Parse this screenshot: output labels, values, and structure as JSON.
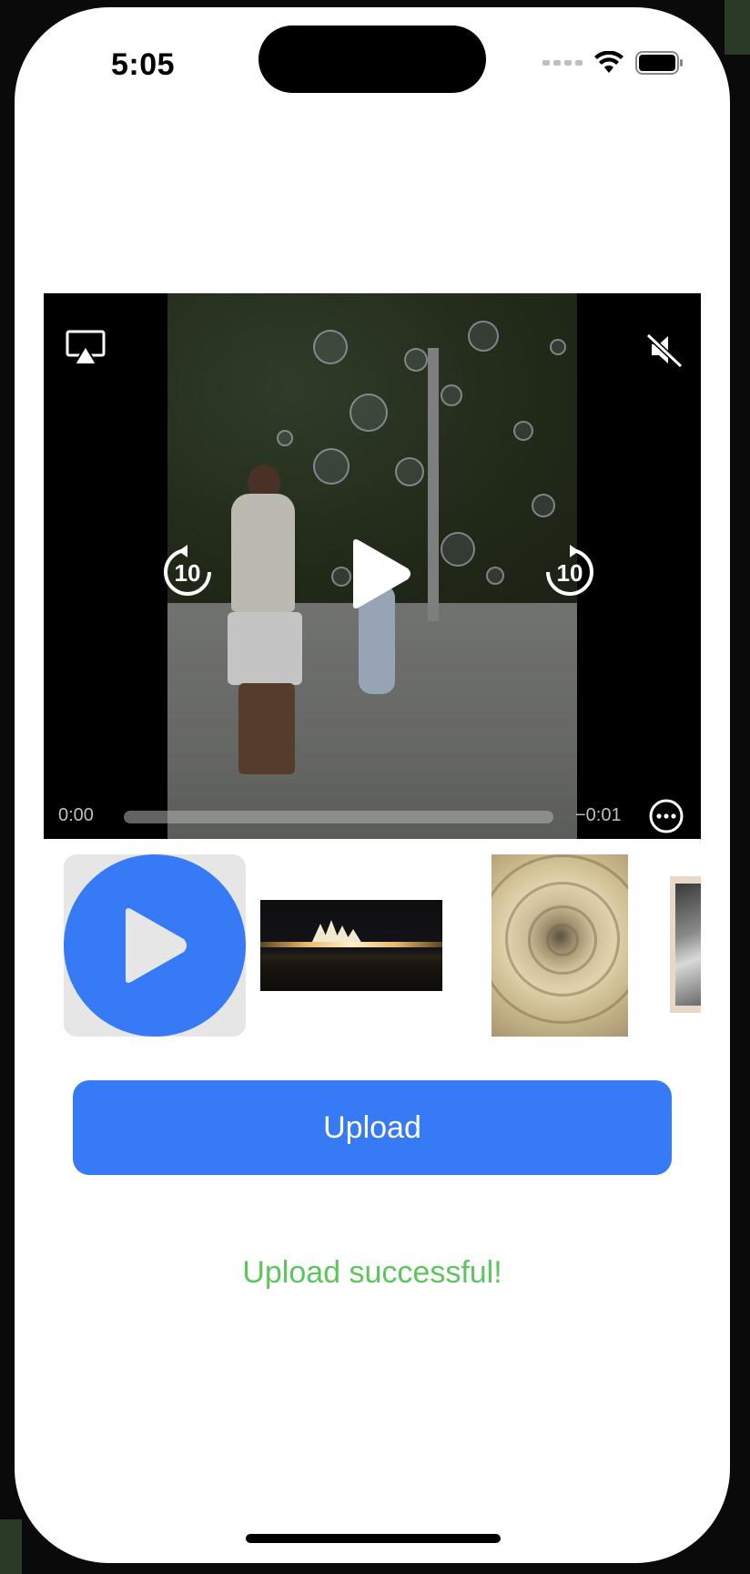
{
  "status_bar": {
    "time": "5:05",
    "icons": [
      "cellular-signal-icon",
      "wifi-icon",
      "battery-icon"
    ]
  },
  "video_player": {
    "elapsed": "0:00",
    "remaining": "−0:01",
    "progress": 0,
    "skip_back_label": "10",
    "skip_forward_label": "10",
    "icons": [
      "airplay-icon",
      "mute-icon",
      "skip-back-10-icon",
      "play-icon",
      "skip-forward-10-icon",
      "more-options-icon"
    ]
  },
  "thumbnails": [
    {
      "kind": "video",
      "icon": "play-icon",
      "accent": "#377AF5"
    },
    {
      "kind": "image",
      "subject": "opera-house-night"
    },
    {
      "kind": "image",
      "subject": "spiral-staircase"
    },
    {
      "kind": "image",
      "subject": "portrait-photo"
    }
  ],
  "upload": {
    "button_label": "Upload",
    "status_text": "Upload successful!",
    "button_color": "#377AF5",
    "status_color": "#5CC65C"
  }
}
